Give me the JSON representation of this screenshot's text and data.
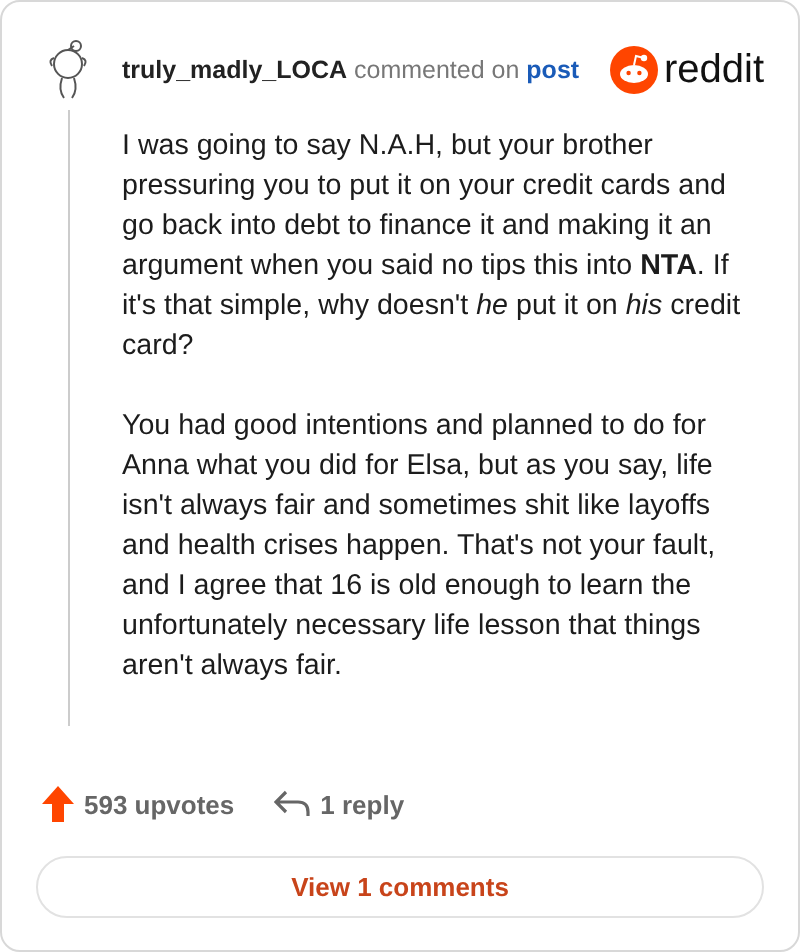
{
  "comment": {
    "author": "truly_madly_LOCA",
    "action": "commented on",
    "target": "post",
    "brand": "reddit",
    "paragraphs": [
      "I was going to say N.A.H, but your brother pressuring you to put it on your credit cards and go back into debt to finance it and making it an argument when you said no tips this into **NTA**. If it's that simple, why doesn't *he* put it on *his* credit card?",
      "You had good intentions and planned to do for Anna what you did for Elsa, but as you say, life isn't always fair and sometimes shit like layoffs and health crises happen. That's not your fault, and I agree that 16 is old enough to learn the unfortunately necessary life lesson that things aren't always fair."
    ],
    "upvotes": "593 upvotes",
    "replies": "1 reply",
    "view_button": "View 1 comments"
  }
}
